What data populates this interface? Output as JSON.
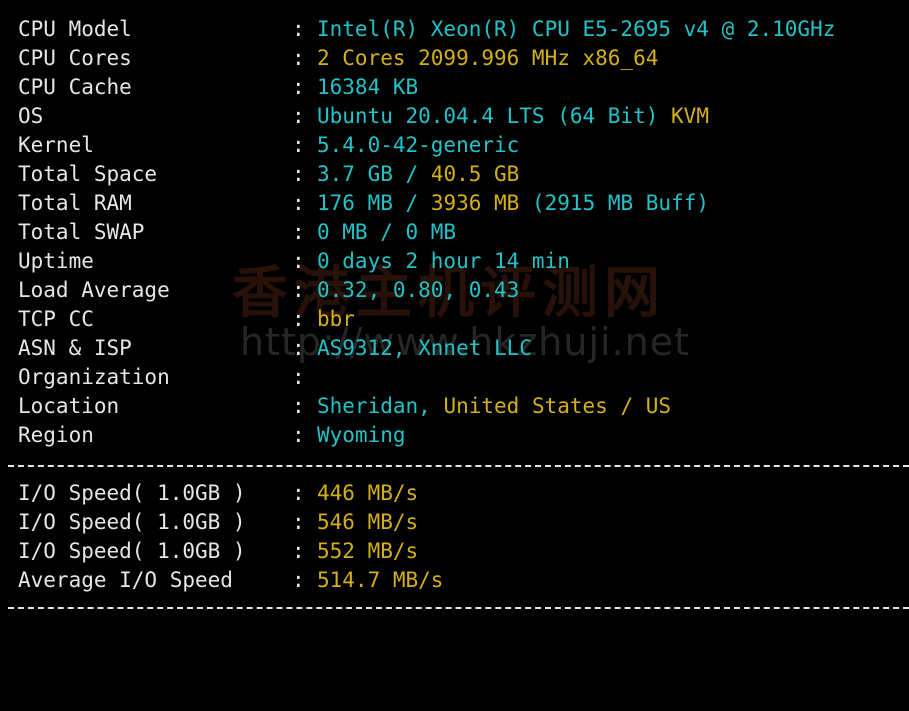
{
  "colors": {
    "background": "#000000",
    "label": "#e6e6e6",
    "value_cyan": "#22c3c8",
    "value_yellow": "#d4b017",
    "watermark": "#2a120a"
  },
  "watermark": {
    "cn": "香港主机评测网",
    "url": "http://www.hkzhuji.net"
  },
  "separator": "--------------------------------------------------------------------------",
  "sysinfo": {
    "cpu_model": {
      "label": "CPU Model",
      "value": "Intel(R) Xeon(R) CPU E5-2695 v4 @ 2.10GHz"
    },
    "cpu_cores": {
      "label": "CPU Cores",
      "value": "2 Cores 2099.996 MHz x86_64"
    },
    "cpu_cache": {
      "label": "CPU Cache",
      "value": "16384 KB"
    },
    "os": {
      "label": "OS",
      "value": "Ubuntu 20.04.4 LTS (64 Bit)",
      "virt": "KVM"
    },
    "kernel": {
      "label": "Kernel",
      "value": "5.4.0-42-generic"
    },
    "total_space": {
      "label": "Total Space",
      "used": "3.7 GB",
      "sep": "/",
      "total": "40.5 GB"
    },
    "total_ram": {
      "label": "Total RAM",
      "used": "176 MB",
      "sep": "/",
      "total": "3936 MB",
      "buff": "(2915 MB Buff)"
    },
    "total_swap": {
      "label": "Total SWAP",
      "value": "0 MB / 0 MB"
    },
    "uptime": {
      "label": "Uptime",
      "value": "0 days 2 hour 14 min"
    },
    "load_average": {
      "label": "Load Average",
      "value": "0.32, 0.80, 0.43"
    },
    "tcp_cc": {
      "label": "TCP CC",
      "value": "bbr"
    },
    "asn_isp": {
      "label": "ASN & ISP",
      "value": "AS9312, Xnnet LLC"
    },
    "organization": {
      "label": "Organization",
      "value": ""
    },
    "location": {
      "label": "Location",
      "city": "Sheridan,",
      "country": "United States / US"
    },
    "region": {
      "label": "Region",
      "value": "Wyoming"
    }
  },
  "io": [
    {
      "label": "I/O Speed( 1.0GB )",
      "value": "446 MB/s"
    },
    {
      "label": "I/O Speed( 1.0GB )",
      "value": "546 MB/s"
    },
    {
      "label": "I/O Speed( 1.0GB )",
      "value": "552 MB/s"
    },
    {
      "label": "Average I/O Speed",
      "value": "514.7 MB/s"
    }
  ],
  "colon": ":"
}
